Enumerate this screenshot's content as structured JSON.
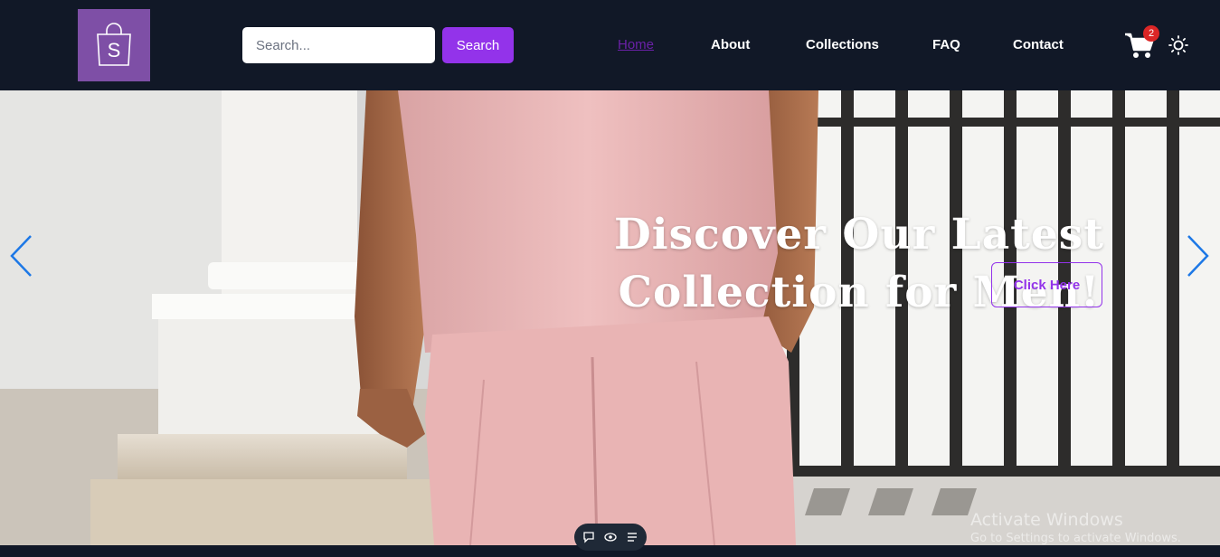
{
  "logo": {
    "letter": "S",
    "icon": "shopping-bag-icon"
  },
  "search": {
    "placeholder": "Search...",
    "value": "",
    "button_label": "Search"
  },
  "nav": {
    "items": [
      {
        "label": "Home",
        "active": true
      },
      {
        "label": "About",
        "active": false
      },
      {
        "label": "Collections",
        "active": false
      },
      {
        "label": "FAQ",
        "active": false
      },
      {
        "label": "Contact",
        "active": false
      }
    ]
  },
  "cart": {
    "icon": "cart-icon",
    "count": "2"
  },
  "theme_toggle": {
    "icon": "sun-icon"
  },
  "hero": {
    "title_line1": "Discover Our Latest",
    "title_line2": "Collection for Men!",
    "cta_label": "Click Here",
    "prev_icon": "chevron-left-icon",
    "next_icon": "chevron-right-icon"
  },
  "carousel_controls": [
    "comment-icon",
    "eye-icon",
    "list-icon"
  ],
  "watermark": {
    "title": "Activate Windows",
    "subtitle": "Go to Settings to activate Windows."
  },
  "colors": {
    "nav_bg": "#111827",
    "accent": "#9333ea",
    "logo_bg": "#7e4fa6",
    "badge": "#dc2626",
    "arrow": "#1d78e6"
  }
}
